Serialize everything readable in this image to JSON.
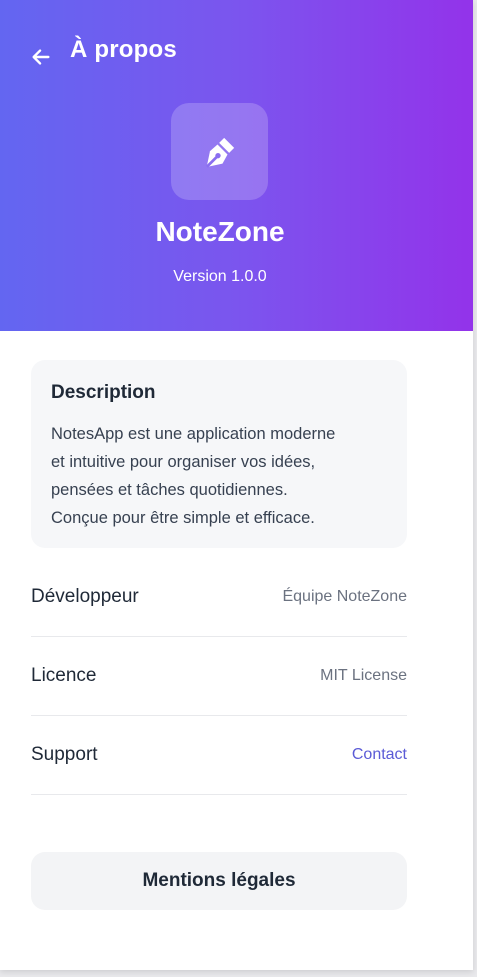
{
  "header": {
    "back_icon": "arrow-left-icon",
    "title": "À propos"
  },
  "app": {
    "icon": "pen-nib-icon",
    "name": "NoteZone",
    "version": "Version 1.0.0"
  },
  "description": {
    "title": "Description",
    "lines": [
      "NotesApp est une application moderne",
      "et intuitive pour organiser vos idées,",
      "pensées et tâches quotidiennes.",
      "Conçue pour être simple et efficace."
    ]
  },
  "info": [
    {
      "label": "Développeur",
      "value": "Équipe NoteZone"
    },
    {
      "label": "Licence",
      "value": "MIT License"
    },
    {
      "label": "Support",
      "value": "Contact"
    }
  ],
  "legal_button": "Mentions légales",
  "colors": {
    "gradient_start": "#6366f1",
    "gradient_end": "#9333ea",
    "link": "#5b5bd6"
  }
}
